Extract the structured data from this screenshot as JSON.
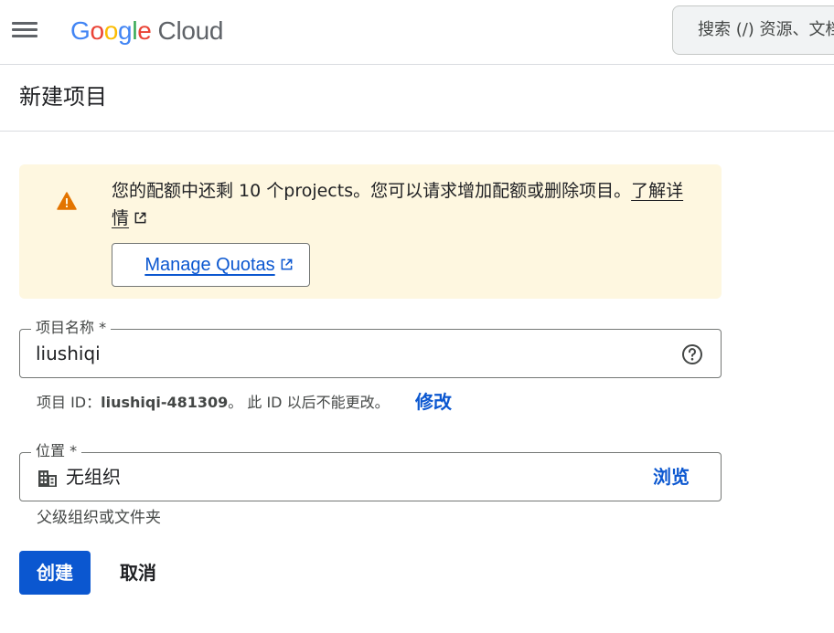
{
  "header": {
    "logo_letters": [
      "G",
      "o",
      "o",
      "g",
      "l",
      "e"
    ],
    "logo_product": "Cloud",
    "search_placeholder": "搜索 (/) 资源、文档"
  },
  "page": {
    "title": "新建项目"
  },
  "quota_banner": {
    "message": "您的配额中还剩 10 个projects。您可以请求增加配额或删除项目。",
    "learn_more_link": "了解详情",
    "manage_button": "Manage Quotas"
  },
  "project_name_field": {
    "label": "项目名称 *",
    "value": "liushiqi"
  },
  "project_id": {
    "prefix": "项目 ID：",
    "value": "liushiqi-481309",
    "suffix": "。 此 ID 以后不能更改。",
    "edit_link": "修改"
  },
  "location_field": {
    "label": "位置 *",
    "value": "无组织",
    "browse_button": "浏览",
    "helper_text": "父级组织或文件夹"
  },
  "actions": {
    "create": "创建",
    "cancel": "取消"
  },
  "colors": {
    "accent": "#0b57d0",
    "warning_bg": "#fef7e0",
    "warning_icon": "#e37400"
  }
}
